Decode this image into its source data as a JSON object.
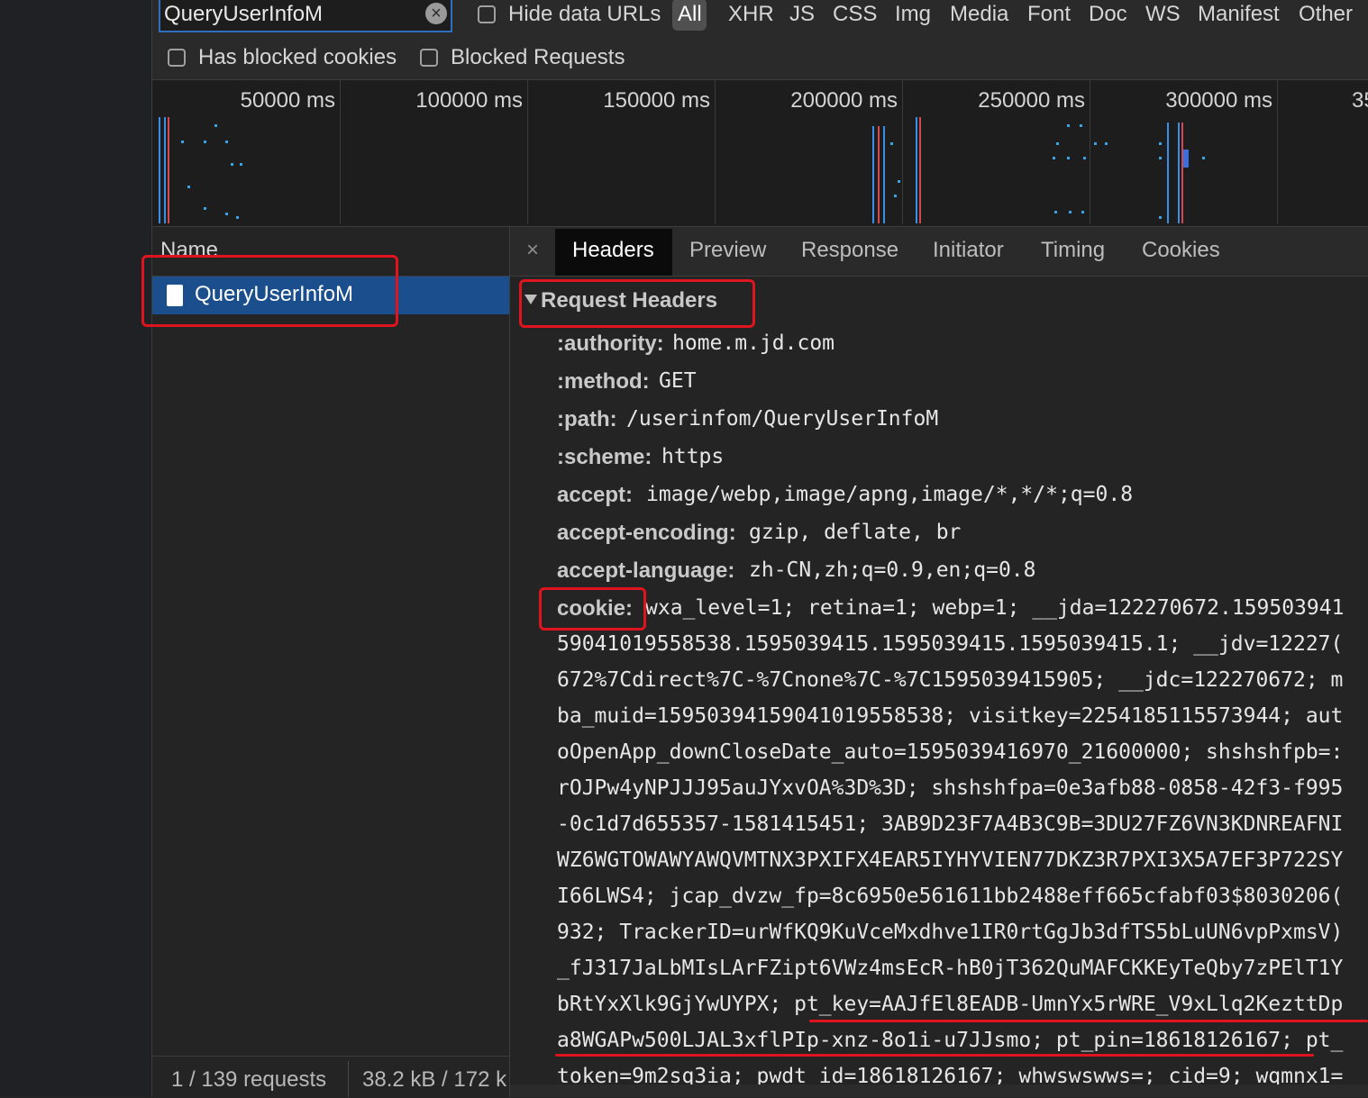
{
  "toolbar": {
    "filter_value": "QueryUserInfoM",
    "hide_data_urls": "Hide data URLs",
    "all": "All",
    "types": [
      "XHR",
      "JS",
      "CSS",
      "Img",
      "Media",
      "Font",
      "Doc",
      "WS",
      "Manifest",
      "Other"
    ],
    "has_blocked_cookies": "Has blocked cookies",
    "blocked_requests": "Blocked Requests"
  },
  "overview": {
    "ticks": [
      "50000 ms",
      "100000 ms",
      "150000 ms",
      "200000 ms",
      "250000 ms",
      "300000 ms",
      "35"
    ]
  },
  "name_pane": {
    "header": "Name",
    "rows": [
      "QueryUserInfoM"
    ],
    "status_requests": "1 / 139 requests",
    "status_size": "38.2 kB / 172 k"
  },
  "detail": {
    "close": "×",
    "tabs": [
      "Headers",
      "Preview",
      "Response",
      "Initiator",
      "Timing",
      "Cookies"
    ],
    "section_title": "Request Headers",
    "headers": [
      {
        "name": ":authority:",
        "value": "home.m.jd.com"
      },
      {
        "name": ":method:",
        "value": "GET"
      },
      {
        "name": ":path:",
        "value": "/userinfom/QueryUserInfoM"
      },
      {
        "name": ":scheme:",
        "value": "https"
      },
      {
        "name": "accept:",
        "value": "image/webp,image/apng,image/*,*/*;q=0.8"
      },
      {
        "name": "accept-encoding:",
        "value": "gzip, deflate, br"
      },
      {
        "name": "accept-language:",
        "value": "zh-CN,zh;q=0.9,en;q=0.8"
      }
    ],
    "cookie_name": "cookie:",
    "cookie_first": "wxa_level=1; retina=1; webp=1; __jda=122270672.159503941",
    "cookie_lines": [
      "59041019558538.1595039415.1595039415.1595039415.1; __jdv=12227(",
      "672%7Cdirect%7C-%7Cnone%7C-%7C1595039415905; __jdc=122270672; m",
      "ba_muid=1595039415904101955853​8; visitkey=2254185115573944; aut",
      "oOpenApp_downCloseDate_auto=1595039416970_21600000; shshshfpb=:",
      "rOJPw4yNPJJJ95auJYxvOA%3D%3D; shshshfpa=0e3afb88-0858-42f3-f995",
      "-0c1d7d655357-1581415451; 3AB9D23F7A4B3C9B=3DU27FZ6VN3KDNREAFNI",
      "WZ6WGTOWAWYAWQVMTNX3PXIFX4EAR5IYHYVIEN77DKZ3R7PXI3X5A7EF3P722SY",
      "I66LWS4; jcap_dvzw_fp=8c6950e561611bb2488eff665cfabf03$8030206(",
      "932; TrackerID=urWfKQ9KuVceMxdhve1IR0rtGgJb3dfTS5bLuUN6vpPxmsV)",
      "_fJ317JaLbMIsLArFZipt6VWz4msEcR-hB0jT362QuMAFCKKEyTeQby7zPElT1Y",
      "bRtYxXlk9GjYwUYPX; pt_key=AAJfEl8EADB-UmnYx5rWRE_V9xLlq2KezttDp",
      "a8WGAPw500LJAL3xflPIp-xnz-8o1i-u7JJsmo; pt_pin=18618126167; pt_",
      "token=9m2sq3ia; pwdt_id=18618126167; whwswswws=; cid=9; wqmnx1="
    ]
  }
}
